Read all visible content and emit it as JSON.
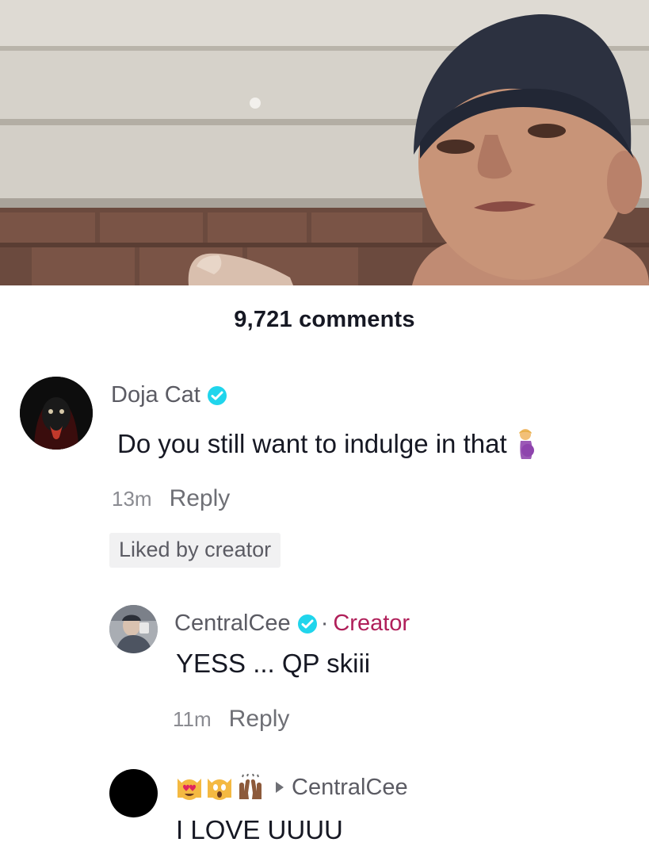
{
  "comments_header": {
    "count_label": "9,721 comments"
  },
  "comments": [
    {
      "username": "Doja Cat",
      "verified": true,
      "text": "Do you still want to indulge in that",
      "emoji": "pregnant-woman-emoji",
      "time": "13m",
      "reply_label": "Reply",
      "badge": "Liked by creator"
    },
    {
      "username": "CentralCee",
      "verified": true,
      "separator": "·",
      "creator_label": "Creator",
      "text": "YESS ... QP skiii",
      "time": "11m",
      "reply_label": "Reply"
    },
    {
      "reply_to": "CentralCee",
      "emoji_name": [
        "heart-eyes-cat-emoji",
        "screaming-cat-emoji",
        "raising-hands-emoji"
      ],
      "text": "I LOVE UUUU"
    }
  ],
  "colors": {
    "creator_accent": "#b0205a",
    "verified_blue": "#20d5ec",
    "text_primary": "#161823",
    "text_secondary": "#5b5b63"
  }
}
